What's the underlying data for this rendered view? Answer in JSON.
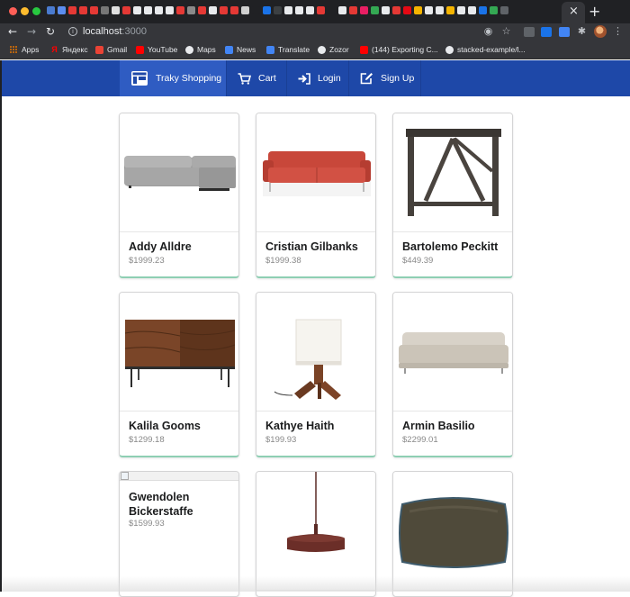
{
  "browser": {
    "url_host": "localhost",
    "url_port": ":3000",
    "tab_close": "×",
    "new_tab": "+",
    "bookmarks": [
      {
        "label": "Apps",
        "icon": "apps-grid-icon"
      },
      {
        "label": "Яндекс",
        "icon": "yandex-icon",
        "color": "#ff0000"
      },
      {
        "label": "Gmail",
        "icon": "gmail-icon",
        "color": "#ea4335"
      },
      {
        "label": "YouTube",
        "icon": "youtube-icon",
        "color": "#ff0000"
      },
      {
        "label": "Maps",
        "icon": "globe-icon",
        "color": "#e8eaed"
      },
      {
        "label": "News",
        "icon": "news-icon",
        "color": "#4285f4"
      },
      {
        "label": "Translate",
        "icon": "translate-icon",
        "color": "#4285f4"
      },
      {
        "label": "Zozor",
        "icon": "globe-icon",
        "color": "#e8eaed"
      },
      {
        "label": "(144) Exporting C...",
        "icon": "youtube-icon",
        "color": "#ff0000"
      },
      {
        "label": "stacked-example/l...",
        "icon": "globe-icon",
        "color": "#e8eaed"
      }
    ]
  },
  "navbar": {
    "brand": "Traky Shopping",
    "items": [
      {
        "label": "Cart",
        "icon": "cart-icon"
      },
      {
        "label": "Login",
        "icon": "sign-in-icon"
      },
      {
        "label": "Sign Up",
        "icon": "edit-icon"
      }
    ],
    "colors": {
      "bar": "#1e48a8",
      "active": "#2f5cc2"
    }
  },
  "products": [
    {
      "name": "Addy Alldre",
      "price": "$1999.23",
      "image": "grey-sectional-sofa"
    },
    {
      "name": "Cristian Gilbanks",
      "price": "$1999.38",
      "image": "red-sofa"
    },
    {
      "name": "Bartolemo Peckitt",
      "price": "$449.39",
      "image": "dark-wood-table"
    },
    {
      "name": "Kalila Gooms",
      "price": "$1299.18",
      "image": "walnut-credenza"
    },
    {
      "name": "Kathye Haith",
      "price": "$199.93",
      "image": "table-lamp"
    },
    {
      "name": "Armin Basilio",
      "price": "$2299.01",
      "image": "beige-sofa"
    },
    {
      "name": "Gwendolen Bickerstaffe",
      "price": "$1599.93",
      "image": "broken-image"
    },
    {
      "name": "",
      "price": "",
      "image": "pendant-lamp"
    },
    {
      "name": "",
      "price": "",
      "image": "olive-pillow"
    }
  ]
}
